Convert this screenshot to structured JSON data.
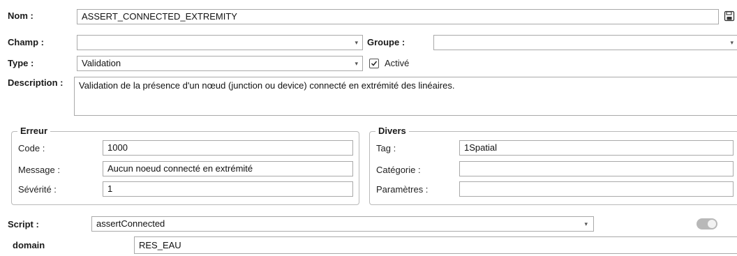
{
  "main": {
    "nom_label": "Nom :",
    "nom_value": "ASSERT_CONNECTED_EXTREMITY",
    "save_icon": "save-icon",
    "champ_label": "Champ :",
    "champ_value": "",
    "groupe_label": "Groupe :",
    "groupe_value": "",
    "type_label": "Type :",
    "type_value": "Validation",
    "active_label": "Activé",
    "active_checked": true,
    "description_label": "Description :",
    "description_value": "Validation de la présence d'un nœud (junction ou device) connecté en extrémité des linéaires."
  },
  "erreur": {
    "title": "Erreur",
    "code_label": "Code :",
    "code_value": "1000",
    "message_label": "Message :",
    "message_value": "Aucun noeud connecté en extrémité",
    "severite_label": "Sévérité :",
    "severite_value": "1"
  },
  "divers": {
    "title": "Divers",
    "tag_label": "Tag :",
    "tag_value": "1Spatial",
    "categorie_label": "Catégorie :",
    "categorie_value": "",
    "parametres_label": "Paramètres :",
    "parametres_value": ""
  },
  "script": {
    "label": "Script :",
    "value": "assertConnected",
    "toggle_on": false
  },
  "params": {
    "domain_label": "domain",
    "domain_value": "RES_EAU"
  }
}
